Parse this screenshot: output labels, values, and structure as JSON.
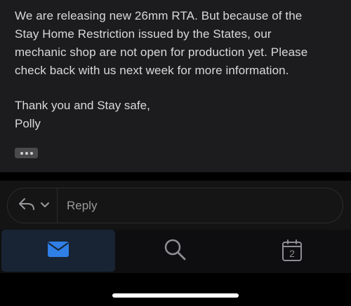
{
  "message": {
    "body_lines": [
      "We are releasing new 26mm RTA. But because of the",
      "Stay Home Restriction issued by the States, our",
      "mechanic shop are not open for production yet. Please",
      "check back with us next week for more information."
    ],
    "signoff_lines": [
      "Thank you and Stay safe,",
      "Polly"
    ],
    "more_icon": "ellipsis-icon"
  },
  "reply_bar": {
    "reply_icon": "reply-arrow-icon",
    "chevron_icon": "chevron-down-icon",
    "placeholder": "Reply"
  },
  "tab_bar": {
    "tabs": [
      {
        "name": "mail",
        "icon": "mail-icon",
        "selected": true
      },
      {
        "name": "search",
        "icon": "search-icon",
        "selected": false
      },
      {
        "name": "calendar",
        "icon": "calendar-icon",
        "day": "2",
        "selected": false
      }
    ]
  },
  "colors": {
    "background": "#000000",
    "message_bg": "#1c1c1e",
    "text": "#d9d9d9",
    "accent": "#2f7fe6",
    "selected_tab_bg": "#182433",
    "muted_icon": "#8e8e93"
  }
}
